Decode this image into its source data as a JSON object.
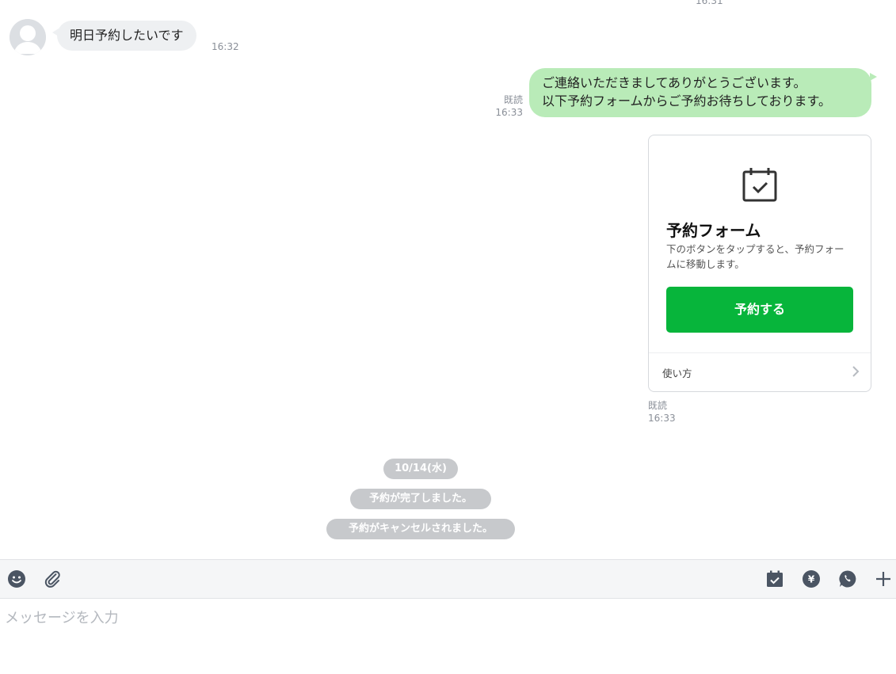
{
  "chat": {
    "top_time": "16:31",
    "incoming": {
      "text": "明日予約したいです",
      "time": "16:32"
    },
    "outgoing_text": {
      "line1": "ご連絡いただきましてありがとうございます。",
      "line2": "以下予約フォームからご予約お待ちしております。",
      "read": "既読",
      "time": "16:33"
    },
    "card": {
      "icon": "calendar-check-icon",
      "title": "予約フォーム",
      "description": "下のボタンをタップすると、予約フォームに移動します。",
      "button_label": "予約する",
      "footer_label": "使い方",
      "read": "既読",
      "time": "16:33"
    },
    "system": {
      "date": "10/14(水)",
      "completed": "予約が完了しました。",
      "cancelled": "予約がキャンセルされました。"
    }
  },
  "toolbar": {
    "left_icons": [
      "emoji-icon",
      "attachment-icon"
    ],
    "right_icons": [
      "calendar-check-icon",
      "yen-icon",
      "call-icon",
      "plus-icon"
    ]
  },
  "input": {
    "placeholder": "メッセージを入力",
    "value": ""
  },
  "colors": {
    "outgoing_bubble": "#b9ebb8",
    "incoming_bubble": "#eef0f2",
    "primary_button": "#07b53b",
    "system_pill": "#c7c9cc",
    "icon_dark": "#4b5563"
  }
}
